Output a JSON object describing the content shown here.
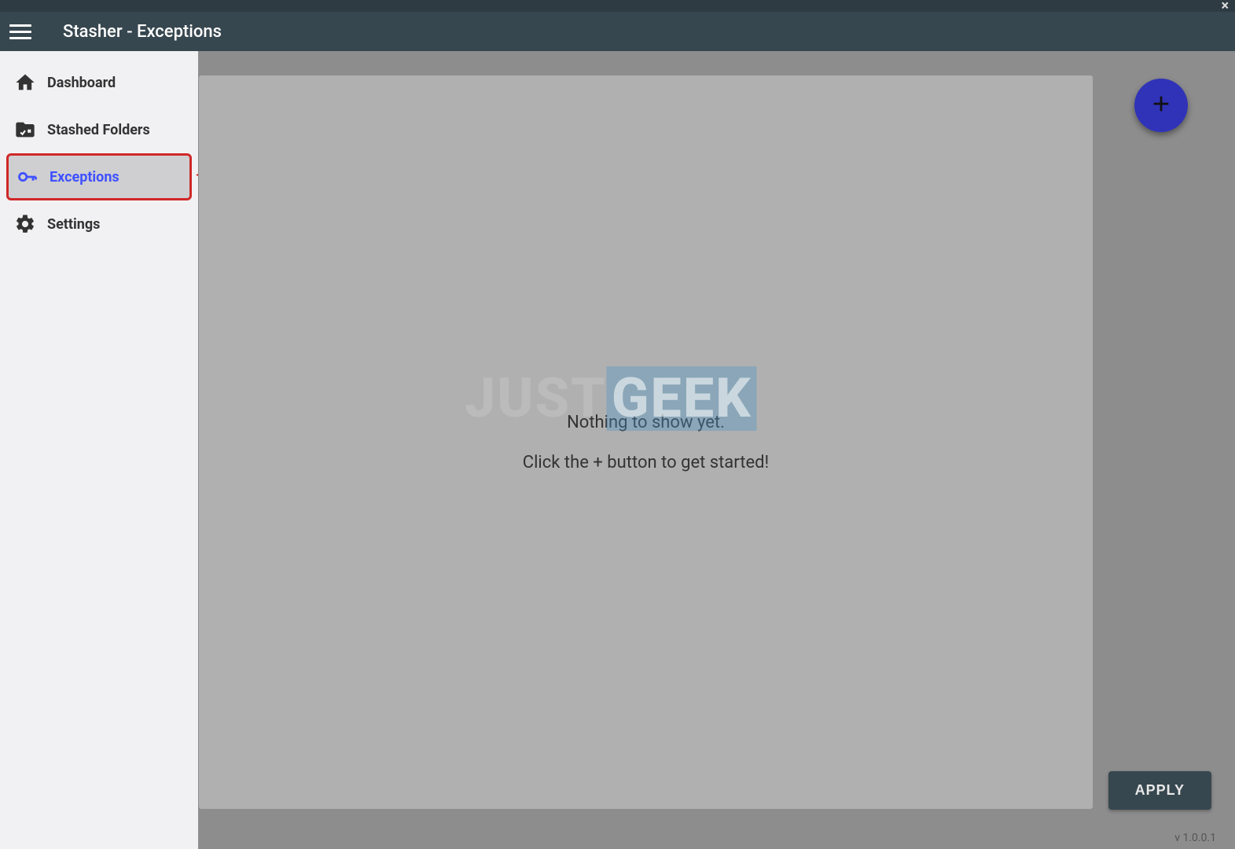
{
  "window": {},
  "appbar": {
    "title": "Stasher - Exceptions"
  },
  "sidebar": {
    "items": [
      {
        "label": "Dashboard",
        "icon": "home-icon",
        "active": false
      },
      {
        "label": "Stashed Folders",
        "icon": "folder-check-x-icon",
        "active": false
      },
      {
        "label": "Exceptions",
        "icon": "key-icon",
        "active": true
      },
      {
        "label": "Settings",
        "icon": "gear-icon",
        "active": false
      }
    ]
  },
  "main": {
    "placeholder_line1": "Nothing to show yet.",
    "placeholder_line2": "Click the + button to get started!",
    "apply_button": "APPLY",
    "version": "v 1.0.0.1"
  },
  "watermark": {
    "part1": "JUST",
    "part2": "GEEK"
  }
}
